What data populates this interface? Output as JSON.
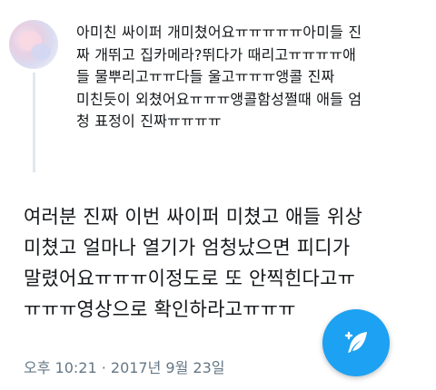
{
  "quoted_tweet": {
    "text": "아미친 싸이퍼 개미쳤어요ㅠㅠㅠㅠㅠ아미들 진\n짜 개뛰고 집카메라?뛰다가 때리고ㅠㅠㅠㅠ애\n들 물뿌리고ㅠㅠ다들 울고ㅠㅠㅠ앵콜 진짜\n미친듯이 외쳤어요ㅠㅠㅠ앵콜함성쩔때 애들 엄\n청 표정이 진짜ㅠㅠㅠㅠ"
  },
  "tweet": {
    "text": "여러분 진짜 이번 싸이퍼 미쳤고 애들 위상\n미쳤고 얼마나 열기가 엄청났으면 피디가\n말렸어요ㅠㅠㅠ이정도로 또 안찍힌다고ㅠ\nㅠㅠㅠ영상으로 확인하라고ㅠㅠㅠ",
    "timestamp": "오후 10:21 · 2017년 9월 23일"
  },
  "fab": {
    "icon": "compose-feather-icon",
    "color": "#1da1f2"
  },
  "colors": {
    "text": "#14171a",
    "meta": "#657786",
    "thread_line": "#e1e8ed"
  }
}
